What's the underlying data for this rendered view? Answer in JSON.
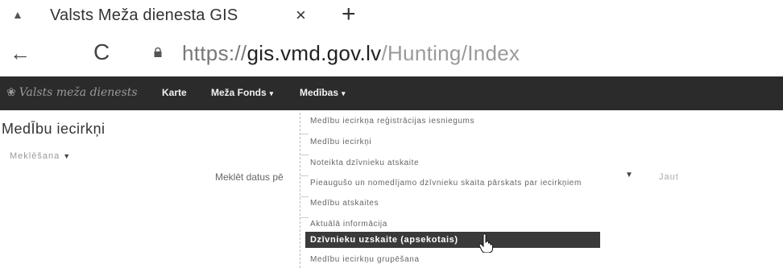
{
  "tab": {
    "title": "Valsts Meža dienesta GIS",
    "close": "×",
    "new": "+",
    "favicon": "leaf-icon"
  },
  "address": {
    "back": "←",
    "reload": "C",
    "url_proto": "https://",
    "url_host": "gis.vmd.gov.lv",
    "url_path": "/Hunting/Index"
  },
  "navbar": {
    "brand": "Valsts meža dienests",
    "items": [
      {
        "label": "Karte"
      },
      {
        "label": "Meža Fonds"
      },
      {
        "label": "Medības"
      }
    ],
    "caret": "▾"
  },
  "page": {
    "heading": "MedĪbu iecirkņi",
    "search_toggle": "Meklēšana",
    "search_label": "Meklēt datus pē",
    "select_right": "Jaut"
  },
  "dropdown": {
    "items": [
      {
        "label": "Medību iecirkņa reģistrācijas iesniegums"
      },
      {
        "label": "Medību iecirkņi"
      },
      {
        "label": "Noteikta dzīvnieku atskaite"
      },
      {
        "label": "Pieaugušo un nomedījamo dzīvnieku skaita pārskats par iecirkņiem"
      },
      {
        "label": "Medību atskaites"
      },
      {
        "label": "Aktuālā informācija"
      },
      {
        "label": "Dzīvnieku uzskaite (apsekotais)"
      },
      {
        "label": "Medību iecirkņu grupēšana"
      }
    ]
  },
  "colors": {
    "navbar": "#2b2b2b",
    "active_item": "#3a3a3a",
    "url_host": "#222222"
  }
}
